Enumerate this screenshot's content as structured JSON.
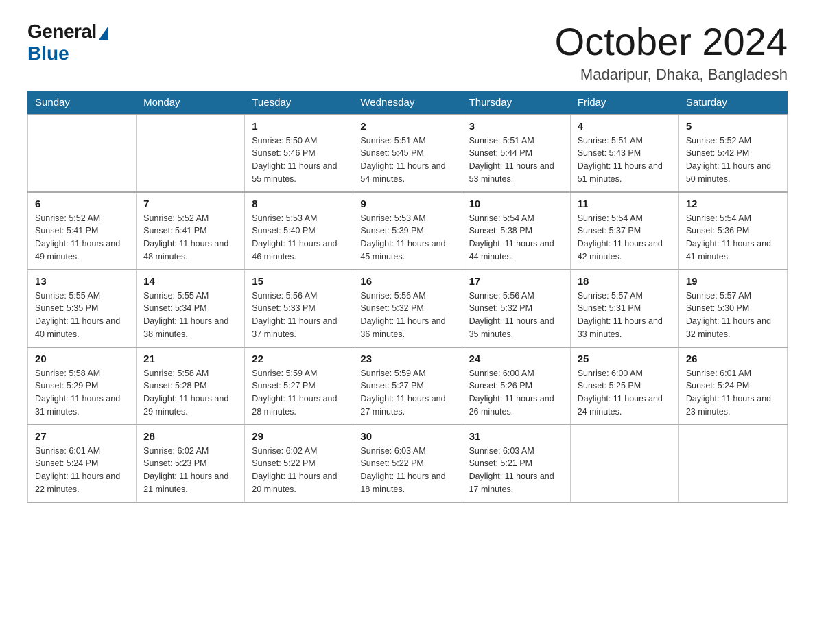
{
  "logo": {
    "general": "General",
    "blue": "Blue"
  },
  "title": "October 2024",
  "location": "Madaripur, Dhaka, Bangladesh",
  "days_header": [
    "Sunday",
    "Monday",
    "Tuesday",
    "Wednesday",
    "Thursday",
    "Friday",
    "Saturday"
  ],
  "weeks": [
    [
      {
        "day": "",
        "sunrise": "",
        "sunset": "",
        "daylight": ""
      },
      {
        "day": "",
        "sunrise": "",
        "sunset": "",
        "daylight": ""
      },
      {
        "day": "1",
        "sunrise": "Sunrise: 5:50 AM",
        "sunset": "Sunset: 5:46 PM",
        "daylight": "Daylight: 11 hours and 55 minutes."
      },
      {
        "day": "2",
        "sunrise": "Sunrise: 5:51 AM",
        "sunset": "Sunset: 5:45 PM",
        "daylight": "Daylight: 11 hours and 54 minutes."
      },
      {
        "day": "3",
        "sunrise": "Sunrise: 5:51 AM",
        "sunset": "Sunset: 5:44 PM",
        "daylight": "Daylight: 11 hours and 53 minutes."
      },
      {
        "day": "4",
        "sunrise": "Sunrise: 5:51 AM",
        "sunset": "Sunset: 5:43 PM",
        "daylight": "Daylight: 11 hours and 51 minutes."
      },
      {
        "day": "5",
        "sunrise": "Sunrise: 5:52 AM",
        "sunset": "Sunset: 5:42 PM",
        "daylight": "Daylight: 11 hours and 50 minutes."
      }
    ],
    [
      {
        "day": "6",
        "sunrise": "Sunrise: 5:52 AM",
        "sunset": "Sunset: 5:41 PM",
        "daylight": "Daylight: 11 hours and 49 minutes."
      },
      {
        "day": "7",
        "sunrise": "Sunrise: 5:52 AM",
        "sunset": "Sunset: 5:41 PM",
        "daylight": "Daylight: 11 hours and 48 minutes."
      },
      {
        "day": "8",
        "sunrise": "Sunrise: 5:53 AM",
        "sunset": "Sunset: 5:40 PM",
        "daylight": "Daylight: 11 hours and 46 minutes."
      },
      {
        "day": "9",
        "sunrise": "Sunrise: 5:53 AM",
        "sunset": "Sunset: 5:39 PM",
        "daylight": "Daylight: 11 hours and 45 minutes."
      },
      {
        "day": "10",
        "sunrise": "Sunrise: 5:54 AM",
        "sunset": "Sunset: 5:38 PM",
        "daylight": "Daylight: 11 hours and 44 minutes."
      },
      {
        "day": "11",
        "sunrise": "Sunrise: 5:54 AM",
        "sunset": "Sunset: 5:37 PM",
        "daylight": "Daylight: 11 hours and 42 minutes."
      },
      {
        "day": "12",
        "sunrise": "Sunrise: 5:54 AM",
        "sunset": "Sunset: 5:36 PM",
        "daylight": "Daylight: 11 hours and 41 minutes."
      }
    ],
    [
      {
        "day": "13",
        "sunrise": "Sunrise: 5:55 AM",
        "sunset": "Sunset: 5:35 PM",
        "daylight": "Daylight: 11 hours and 40 minutes."
      },
      {
        "day": "14",
        "sunrise": "Sunrise: 5:55 AM",
        "sunset": "Sunset: 5:34 PM",
        "daylight": "Daylight: 11 hours and 38 minutes."
      },
      {
        "day": "15",
        "sunrise": "Sunrise: 5:56 AM",
        "sunset": "Sunset: 5:33 PM",
        "daylight": "Daylight: 11 hours and 37 minutes."
      },
      {
        "day": "16",
        "sunrise": "Sunrise: 5:56 AM",
        "sunset": "Sunset: 5:32 PM",
        "daylight": "Daylight: 11 hours and 36 minutes."
      },
      {
        "day": "17",
        "sunrise": "Sunrise: 5:56 AM",
        "sunset": "Sunset: 5:32 PM",
        "daylight": "Daylight: 11 hours and 35 minutes."
      },
      {
        "day": "18",
        "sunrise": "Sunrise: 5:57 AM",
        "sunset": "Sunset: 5:31 PM",
        "daylight": "Daylight: 11 hours and 33 minutes."
      },
      {
        "day": "19",
        "sunrise": "Sunrise: 5:57 AM",
        "sunset": "Sunset: 5:30 PM",
        "daylight": "Daylight: 11 hours and 32 minutes."
      }
    ],
    [
      {
        "day": "20",
        "sunrise": "Sunrise: 5:58 AM",
        "sunset": "Sunset: 5:29 PM",
        "daylight": "Daylight: 11 hours and 31 minutes."
      },
      {
        "day": "21",
        "sunrise": "Sunrise: 5:58 AM",
        "sunset": "Sunset: 5:28 PM",
        "daylight": "Daylight: 11 hours and 29 minutes."
      },
      {
        "day": "22",
        "sunrise": "Sunrise: 5:59 AM",
        "sunset": "Sunset: 5:27 PM",
        "daylight": "Daylight: 11 hours and 28 minutes."
      },
      {
        "day": "23",
        "sunrise": "Sunrise: 5:59 AM",
        "sunset": "Sunset: 5:27 PM",
        "daylight": "Daylight: 11 hours and 27 minutes."
      },
      {
        "day": "24",
        "sunrise": "Sunrise: 6:00 AM",
        "sunset": "Sunset: 5:26 PM",
        "daylight": "Daylight: 11 hours and 26 minutes."
      },
      {
        "day": "25",
        "sunrise": "Sunrise: 6:00 AM",
        "sunset": "Sunset: 5:25 PM",
        "daylight": "Daylight: 11 hours and 24 minutes."
      },
      {
        "day": "26",
        "sunrise": "Sunrise: 6:01 AM",
        "sunset": "Sunset: 5:24 PM",
        "daylight": "Daylight: 11 hours and 23 minutes."
      }
    ],
    [
      {
        "day": "27",
        "sunrise": "Sunrise: 6:01 AM",
        "sunset": "Sunset: 5:24 PM",
        "daylight": "Daylight: 11 hours and 22 minutes."
      },
      {
        "day": "28",
        "sunrise": "Sunrise: 6:02 AM",
        "sunset": "Sunset: 5:23 PM",
        "daylight": "Daylight: 11 hours and 21 minutes."
      },
      {
        "day": "29",
        "sunrise": "Sunrise: 6:02 AM",
        "sunset": "Sunset: 5:22 PM",
        "daylight": "Daylight: 11 hours and 20 minutes."
      },
      {
        "day": "30",
        "sunrise": "Sunrise: 6:03 AM",
        "sunset": "Sunset: 5:22 PM",
        "daylight": "Daylight: 11 hours and 18 minutes."
      },
      {
        "day": "31",
        "sunrise": "Sunrise: 6:03 AM",
        "sunset": "Sunset: 5:21 PM",
        "daylight": "Daylight: 11 hours and 17 minutes."
      },
      {
        "day": "",
        "sunrise": "",
        "sunset": "",
        "daylight": ""
      },
      {
        "day": "",
        "sunrise": "",
        "sunset": "",
        "daylight": ""
      }
    ]
  ]
}
